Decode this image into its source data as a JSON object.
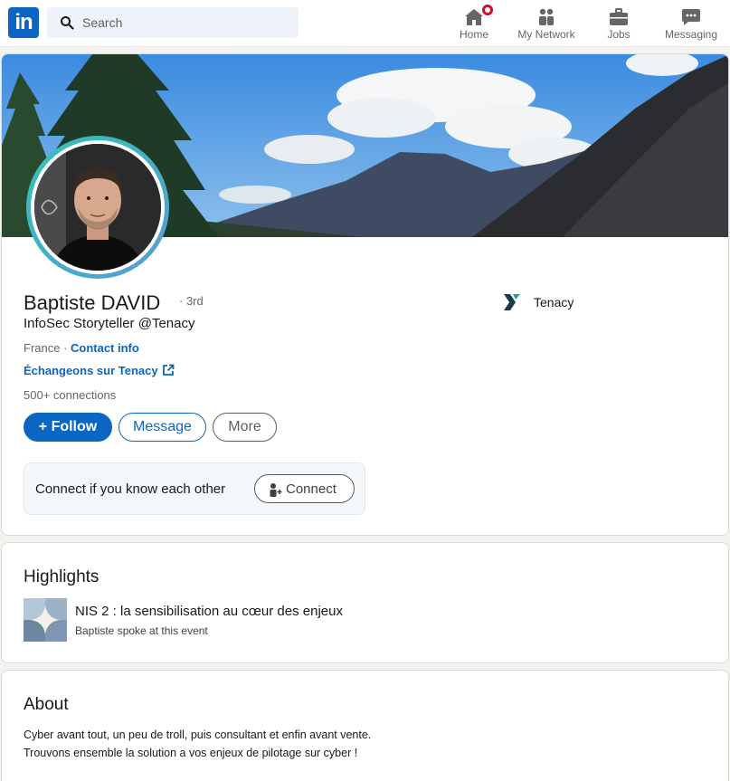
{
  "nav": {
    "logo_text": "in",
    "search_placeholder": "Search",
    "items": [
      {
        "label": "Home",
        "icon": "home-icon",
        "has_notification": true
      },
      {
        "label": "My Network",
        "icon": "network-icon"
      },
      {
        "label": "Jobs",
        "icon": "briefcase-icon"
      },
      {
        "label": "Messaging",
        "icon": "messaging-icon"
      }
    ]
  },
  "profile": {
    "name": "Baptiste DAVID",
    "degree": "· 3rd",
    "headline": "InfoSec Storyteller @Tenacy",
    "location": "France ·",
    "contact_info": "Contact info",
    "website_link": "Échangeons sur Tenacy",
    "connections": "500+ connections",
    "company": "Tenacy",
    "buttons": {
      "follow": "Follow",
      "message": "Message",
      "more": "More"
    },
    "connect_prompt": "Connect if you know each other",
    "connect_button": "Connect"
  },
  "highlights": {
    "title": "Highlights",
    "item_title": "NIS 2 : la sensibilisation au cœur des enjeux",
    "item_subtitle": "Baptiste spoke at this event"
  },
  "about": {
    "title": "About",
    "lines": [
      "Cyber avant tout, un peu de troll, puis consultant et enfin avant vente.",
      "Trouvons ensemble la solution a vos enjeux de pilotage sur cyber !"
    ]
  },
  "colors": {
    "brand": "#0a66c2",
    "notification": "#cb112d",
    "background": "#f4f2ee"
  }
}
